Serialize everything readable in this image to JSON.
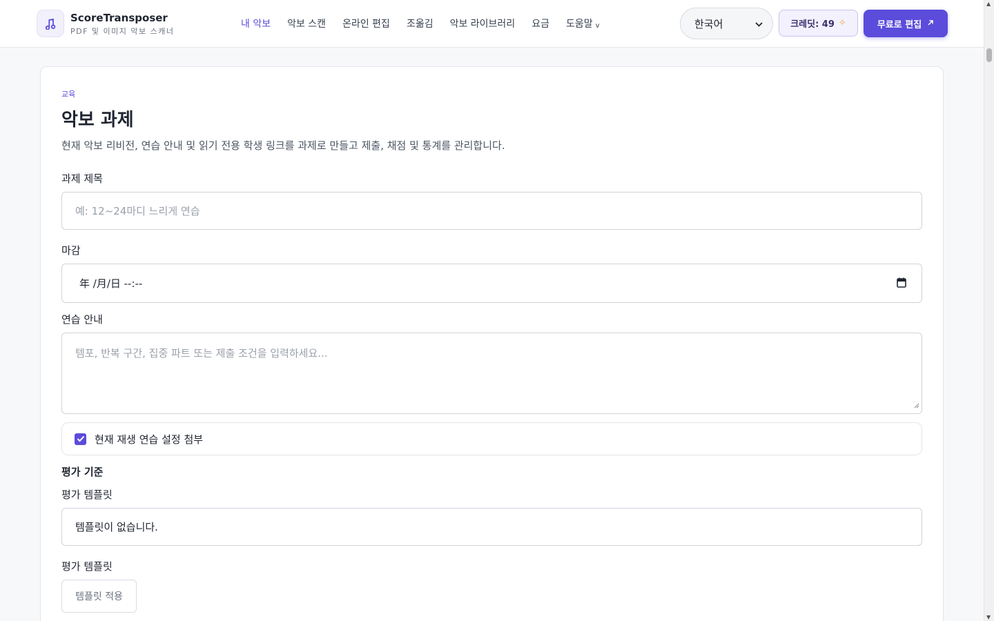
{
  "header": {
    "app_name": "ScoreTransposer",
    "app_tagline": "PDF 및 이미지 악보 스캐너",
    "nav": [
      {
        "label": "내 악보",
        "active": true
      },
      {
        "label": "악보 스캔"
      },
      {
        "label": "온라인 편집"
      },
      {
        "label": "조옮김"
      },
      {
        "label": "악보 라이브러리"
      },
      {
        "label": "요금"
      },
      {
        "label": "도움말"
      }
    ],
    "language": "한국어",
    "credits_label": "크레딧: 49",
    "edit_button": "무료로 편집",
    "accent_color": "#5b4cdb"
  },
  "page": {
    "eyebrow": "교육",
    "title": "악보 과제",
    "description": "현재 악보 리비전, 연습 안내 및 읽기 전용 학생 링크를 과제로 만들고 제출, 채점 및 통계를 관리합니다."
  },
  "form": {
    "title_label": "과제 제목",
    "title_placeholder": "예: 12~24마디 느리게 연습",
    "due_label": "마감",
    "due_value": "年 /月/日 --:--",
    "notes_label": "연습 안내",
    "notes_placeholder": "템포, 반복 구간, 집중 파트 또는 제출 조건을 입력하세요...",
    "attach_label": "현재 재생 연습 설정 첨부",
    "attach_checked": true,
    "rubric_section": "평가 기준",
    "template_label": "평가 템플릿",
    "template_value": "템플릿이 없습니다.",
    "template_label_2": "평가 템플릿",
    "apply_button": "템플릿 적용"
  }
}
